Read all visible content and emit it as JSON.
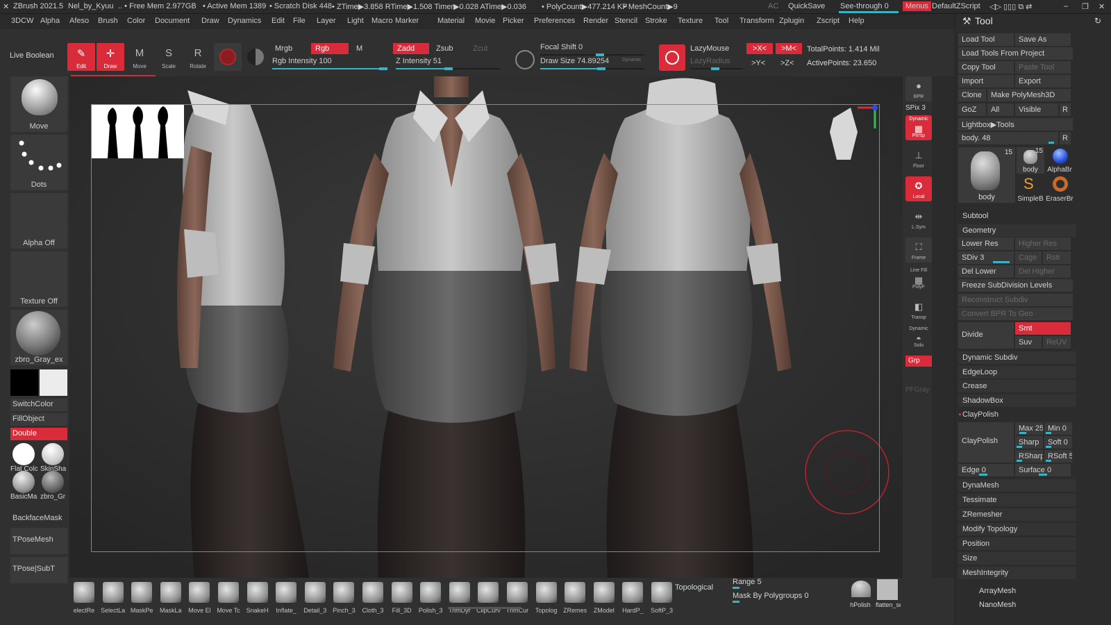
{
  "titlebar": {
    "app": "ZBrush 2021.5",
    "doc": "Nel_by_Kyuu",
    "free_mem": ".. • Free Mem 2.977GB",
    "active_mem": "• Active Mem 1389",
    "scratch": "• Scratch Disk 448",
    "ztime": "• ZTime▶3.858 RTime▶1.508 Timer▶0.028 ATime▶0.036",
    "poly": "• PolyCount▶477.214 KP",
    "mesh": "• MeshCount▶9",
    "ac": "AC",
    "quicksave": "QuickSave",
    "seethrough": "See-through  0",
    "menus": "Menus",
    "defaultzscript": "DefaultZScript"
  },
  "menu": [
    "3DCW",
    "Alpha",
    "Afeso",
    "Brush",
    "Color",
    "Document",
    "Draw",
    "Dynamics",
    "Edit",
    "File",
    "Layer",
    "Light",
    "Macro",
    "Marker",
    "Material",
    "Movie",
    "Picker",
    "Preferences",
    "Render",
    "Stencil",
    "Stroke",
    "Texture",
    "Tool",
    "Transform",
    "Zplugin",
    "Zscript",
    "Help"
  ],
  "toolbar": {
    "live_boolean": "Live Boolean",
    "edit": "Edit",
    "draw": "Draw",
    "move": "Move",
    "scale": "Scale",
    "rotate": "Rotate",
    "mrgb": "Mrgb",
    "rgb": "Rgb",
    "m": "M",
    "rgb_intensity": "Rgb Intensity 100",
    "zadd": "Zadd",
    "zsub": "Zsub",
    "zcut": "Zcut",
    "z_intensity": "Z Intensity 51",
    "focal_shift": "Focal Shift 0",
    "draw_size": "Draw Size 74.89254",
    "dynamic": "Dynamic",
    "lazymouse": "LazyMouse",
    "lazyradius": "LazyRadius",
    "x_sym": ">X<",
    "m_sym": ">M<",
    "y_sym": ">Y<",
    "z_sym": ">Z<",
    "total_points": "TotalPoints: 1.414 Mil",
    "active_points": "ActivePoints: 23.650",
    "rgb_intensity_value": 100,
    "z_intensity_value": 51
  },
  "left": {
    "brush": "Move",
    "stroke": "Dots",
    "alpha": "Alpha Off",
    "texture": "Texture Off",
    "material": "zbro_Gray_ex",
    "switch_color": "SwitchColor",
    "fill_object": "FillObject",
    "double": "Double",
    "mat1": "Flat Colc",
    "mat2": "SkinSha",
    "mat3": "BasicMa",
    "mat4": "zbro_Gr",
    "backface": "BackfaceMask",
    "tposemesh": "TPoseMesh",
    "tposesubt": "TPose|SubT"
  },
  "rightcol": {
    "bpr": "BPR",
    "spix": "SPix 3",
    "persp": "Persp",
    "dynamic": "Dynamic",
    "floor": "Floor",
    "local": "Local",
    "lsym": "L.Sym",
    "frame": "Frame",
    "linefill": "Line Fill",
    "polyf": "PolyF",
    "transp": "Transp",
    "dynamic2": "Dynamic",
    "solo": "Solo",
    "grp": "Grp",
    "pfgray": "PFGray"
  },
  "tool": {
    "title": "Tool",
    "load_tool": "Load Tool",
    "save_as": "Save As",
    "load_from_project": "Load Tools From Project",
    "copy_tool": "Copy Tool",
    "paste_tool": "Paste Tool",
    "import": "Import",
    "export": "Export",
    "clone": "Clone",
    "make_polymesh": "Make PolyMesh3D",
    "goz": "GoZ",
    "all": "All",
    "visible": "Visible",
    "r": "R",
    "lightbox": "Lightbox▶Tools",
    "body_slider": "body. 48",
    "thumbs": [
      {
        "name": "body",
        "count": "15"
      },
      {
        "name": "body",
        "count": "15"
      },
      {
        "name": "AlphaBr",
        "count": ""
      },
      {
        "name": "SimpleB",
        "count": ""
      },
      {
        "name": "EraserBr",
        "count": ""
      }
    ],
    "subtool": "Subtool",
    "geometry": "Geometry",
    "lower_res": "Lower Res",
    "higher_res": "Higher Res",
    "sdiv": "SDiv 3",
    "cage": "Cage",
    "rstr": "Rstr",
    "del_lower": "Del Lower",
    "del_higher": "Del Higher",
    "freeze": "Freeze SubDivision Levels",
    "reconstruct": "Reconstruct Subdiv",
    "convert_bpr": "Convert BPR To Geo",
    "divide": "Divide",
    "smt": "Smt",
    "suv": "Suv",
    "reuv": "ReUV",
    "dynamic_subdiv": "Dynamic Subdiv",
    "edgeloop": "EdgeLoop",
    "crease": "Crease",
    "shadowbox": "ShadowBox",
    "claypolish_header": "ClayPolish",
    "claypolish": "ClayPolish",
    "max": "Max 25",
    "min": "Min 0",
    "sharp": "Sharp",
    "soft": "Soft 0",
    "rsharp": "RSharp",
    "rsoft": "RSoft 5",
    "edge": "Edge 0",
    "surface": "Surface 0",
    "dynamesh": "DynaMesh",
    "tessimate": "Tessimate",
    "zremesher": "ZRemesher",
    "modify_topology": "Modify Topology",
    "position": "Position",
    "size": "Size",
    "meshintegrity": "MeshIntegrity",
    "arraymesh": "ArrayMesh",
    "nanomesh": "NanoMesh"
  },
  "bottom": {
    "brushes": [
      "electRe",
      "SelectLa",
      "MaskPe",
      "MaskLa",
      "Move El",
      "Move Tc",
      "SnakeH",
      "Inflate_",
      "Detail_3",
      "Pinch_3",
      "Cloth_3",
      "Fill_3D",
      "Polish_3",
      "TrimDyr",
      "ClipCurv",
      "TrimCur",
      "Topolog",
      "ZRemes",
      "ZModel",
      "HardP_",
      "SoftP_3"
    ],
    "topological": "Topological",
    "range": "Range 5",
    "mask_polygroups": "Mask By Polygroups 0",
    "hpolish": "hPolish",
    "flat": "flatten_se"
  },
  "colors": {
    "accent_red": "#d92b3a",
    "slider_cyan": "#3ab3c6",
    "panel": "#303030"
  }
}
